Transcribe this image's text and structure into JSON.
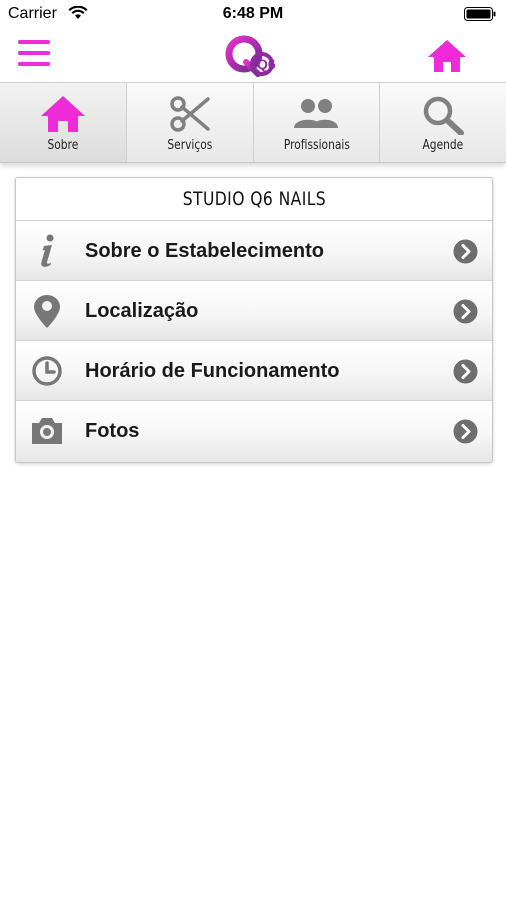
{
  "status_bar": {
    "carrier": "Carrier",
    "time": "6:48 PM"
  },
  "header": {
    "menu_icon": "hamburger-menu-icon",
    "logo_text": "Q6",
    "home_icon": "home-icon"
  },
  "tabs": [
    {
      "label": "Sobre",
      "icon": "home-icon",
      "active": true
    },
    {
      "label": "Serviços",
      "icon": "scissors-icon",
      "active": false
    },
    {
      "label": "Profissionais",
      "icon": "people-icon",
      "active": false
    },
    {
      "label": "Agende",
      "icon": "search-icon",
      "active": false
    }
  ],
  "card": {
    "title": "STUDIO Q6 NAILS",
    "items": [
      {
        "label": "Sobre o Estabelecimento",
        "icon": "info-icon"
      },
      {
        "label": "Localização",
        "icon": "map-pin-icon"
      },
      {
        "label": "Horário de Funcionamento",
        "icon": "clock-icon"
      },
      {
        "label": "Fotos",
        "icon": "camera-icon"
      }
    ]
  },
  "colors": {
    "accent": "#ee2bd6",
    "icon_gray": "#777777",
    "logo_purple": "#8e2c9e"
  }
}
